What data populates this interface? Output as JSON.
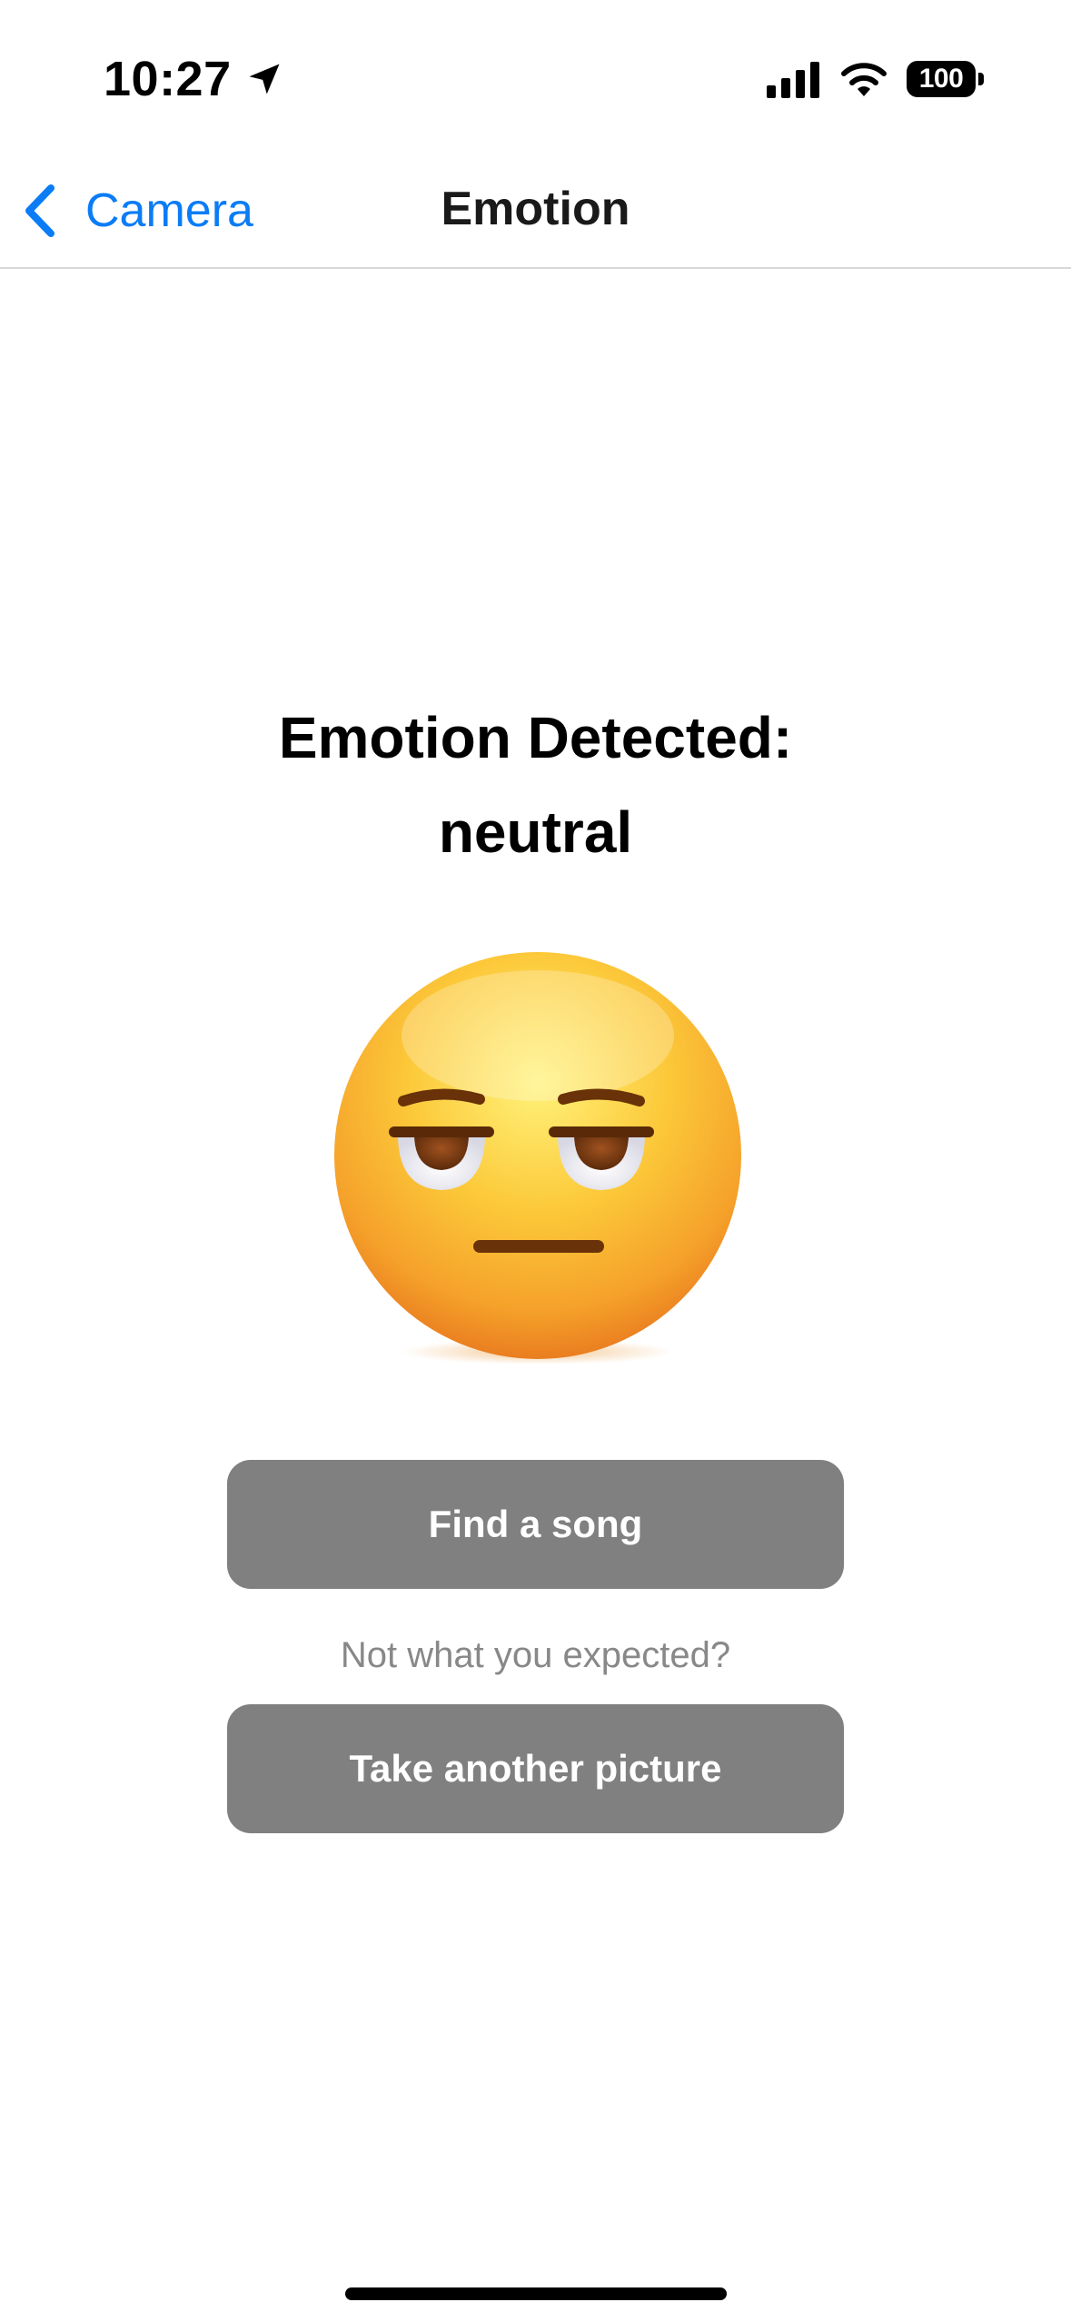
{
  "status_bar": {
    "time": "10:27",
    "battery_level": "100",
    "icons": [
      "location-arrow-icon",
      "cellular-signal-icon",
      "wifi-icon",
      "battery-icon"
    ]
  },
  "nav": {
    "back_label": "Camera",
    "title": "Emotion"
  },
  "content": {
    "heading_line1": "Emotion Detected:",
    "heading_line2": "neutral",
    "emoji": "unamused-face-emoji",
    "find_song_label": "Find a song",
    "hint": "Not what you expected?",
    "retake_label": "Take another picture"
  },
  "colors": {
    "accent": "#0a7cf6",
    "button_bg": "#808080",
    "hint_text": "#888888"
  }
}
